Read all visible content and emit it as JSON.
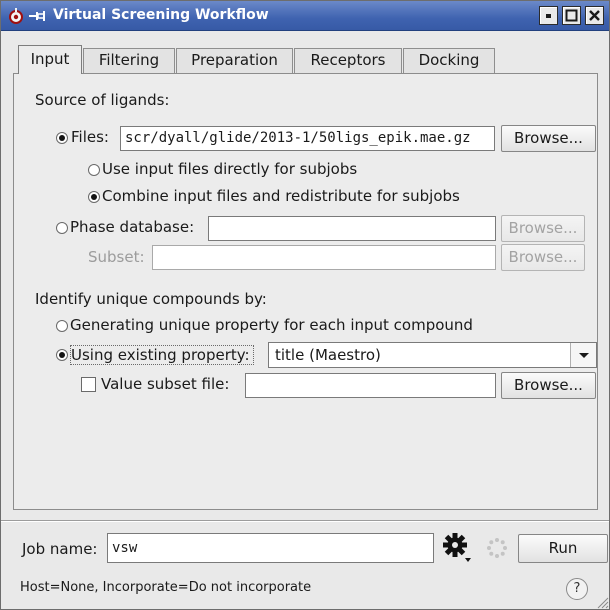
{
  "window": {
    "title": "Virtual Screening Workflow",
    "title_icon": "maestro-app-icon",
    "pin_icon": "pin-icon",
    "controls": [
      "minimize",
      "maximize",
      "close"
    ]
  },
  "tabs": [
    {
      "label": "Input",
      "active": true
    },
    {
      "label": "Filtering",
      "active": false
    },
    {
      "label": "Preparation",
      "active": false
    },
    {
      "label": "Receptors",
      "active": false
    },
    {
      "label": "Docking",
      "active": false
    }
  ],
  "source": {
    "heading": "Source of ligands:",
    "files_label": "Files:",
    "files_value": "scr/dyall/glide/2013-1/50ligs_epik.mae.gz",
    "files_browse": "Browse...",
    "opt_direct": "Use input files directly for subjobs",
    "opt_combine": "Combine input files and redistribute for subjobs",
    "phase_label": "Phase database:",
    "phase_value": "",
    "phase_browse": "Browse...",
    "subset_label": "Subset:",
    "subset_value": "",
    "subset_browse": "Browse..."
  },
  "identify": {
    "heading": "Identify unique compounds by:",
    "opt_generate": "Generating unique property for each input compound",
    "opt_existing": "Using existing property:",
    "property_selected": "title (Maestro)",
    "value_subset_label": "Value subset file:",
    "value_subset_value": "",
    "value_subset_browse": "Browse..."
  },
  "job": {
    "name_label": "Job name:",
    "name_value": "vsw",
    "settings_icon": "gear-icon",
    "progress_icon": "spinner-icon",
    "run_label": "Run"
  },
  "status": {
    "text": "Host=None, Incorporate=Do not incorporate",
    "help_label": "?"
  },
  "colors": {
    "titlebar": "#3f63b0",
    "window_bg": "#e9e9e9"
  }
}
